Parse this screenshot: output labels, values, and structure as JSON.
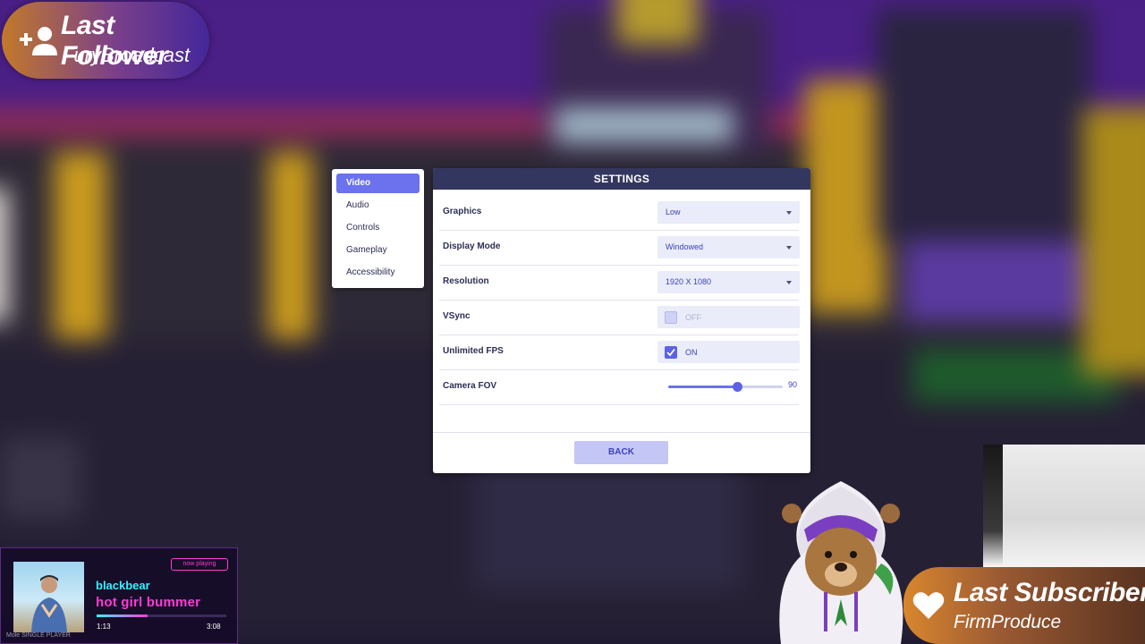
{
  "overlay": {
    "follower": {
      "title": "Last Follower",
      "name": "FuryBroadcast",
      "icon": "add-user-icon"
    },
    "subscriber": {
      "title": "Last Subscriber",
      "name": "FirmProduce",
      "icon": "heart-icon"
    },
    "music": {
      "badge": "now playing",
      "artist": "blackbear",
      "song": "hot girl bummer",
      "elapsed": "1:13",
      "duration": "3:08",
      "progress": 0.39,
      "footer": "Mole  SINGLE PLAYER"
    }
  },
  "settings": {
    "title": "SETTINGS",
    "tabs": [
      {
        "label": "Video",
        "active": true
      },
      {
        "label": "Audio",
        "active": false
      },
      {
        "label": "Controls",
        "active": false
      },
      {
        "label": "Gameplay",
        "active": false
      },
      {
        "label": "Accessibility",
        "active": false
      }
    ],
    "rows": {
      "graphics": {
        "label": "Graphics",
        "value": "Low"
      },
      "display_mode": {
        "label": "Display Mode",
        "value": "Windowed"
      },
      "resolution": {
        "label": "Resolution",
        "value": "1920 X 1080"
      },
      "vsync": {
        "label": "VSync",
        "value": "OFF",
        "checked": false
      },
      "unlimited_fps": {
        "label": "Unlimited FPS",
        "value": "ON",
        "checked": true
      },
      "camera_fov": {
        "label": "Camera FOV",
        "value": "90",
        "min": 60,
        "max": 110
      }
    },
    "back_label": "BACK"
  },
  "colors": {
    "accent": "#6c72ee",
    "header": "#33375f",
    "button": "#c4c6f6",
    "music_cyan": "#38f0ff",
    "music_pink": "#ff3bd4"
  }
}
